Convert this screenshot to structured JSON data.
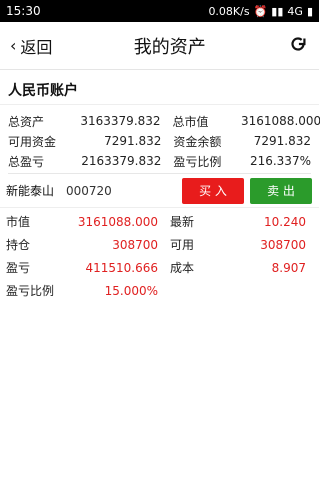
{
  "status_bar": {
    "time": "15:30",
    "network_speed": "0.08K/s",
    "network_type": "4G"
  },
  "header": {
    "back_label": "返回",
    "title": "我的资产"
  },
  "account": {
    "title": "人民币账户",
    "summary": [
      {
        "label": "总资产",
        "value": "3163379.832",
        "label2": "总市值",
        "value2": "3161088.000"
      },
      {
        "label": "可用资金",
        "value": "7291.832",
        "label2": "资金余额",
        "value2": "7291.832"
      },
      {
        "label": "总盈亏",
        "value": "2163379.832",
        "label2": "盈亏比例",
        "value2": "216.337%"
      }
    ]
  },
  "stock": {
    "name": "新能泰山",
    "code": "000720",
    "buy_label": "买 入",
    "sell_label": "卖 出",
    "rows": [
      {
        "label": "市值",
        "value": "3161088.000",
        "label2": "最新",
        "value2": "10.240"
      },
      {
        "label": "持仓",
        "value": "308700",
        "label2": "可用",
        "value2": "308700"
      },
      {
        "label": "盈亏",
        "value": "411510.666",
        "label2": "成本",
        "value2": "8.907"
      },
      {
        "label": "盈亏比例",
        "value": "15.000%"
      }
    ]
  },
  "colors": {
    "buy": "#e81c1c",
    "sell": "#2b9b2b",
    "value_red": "#e02020"
  }
}
